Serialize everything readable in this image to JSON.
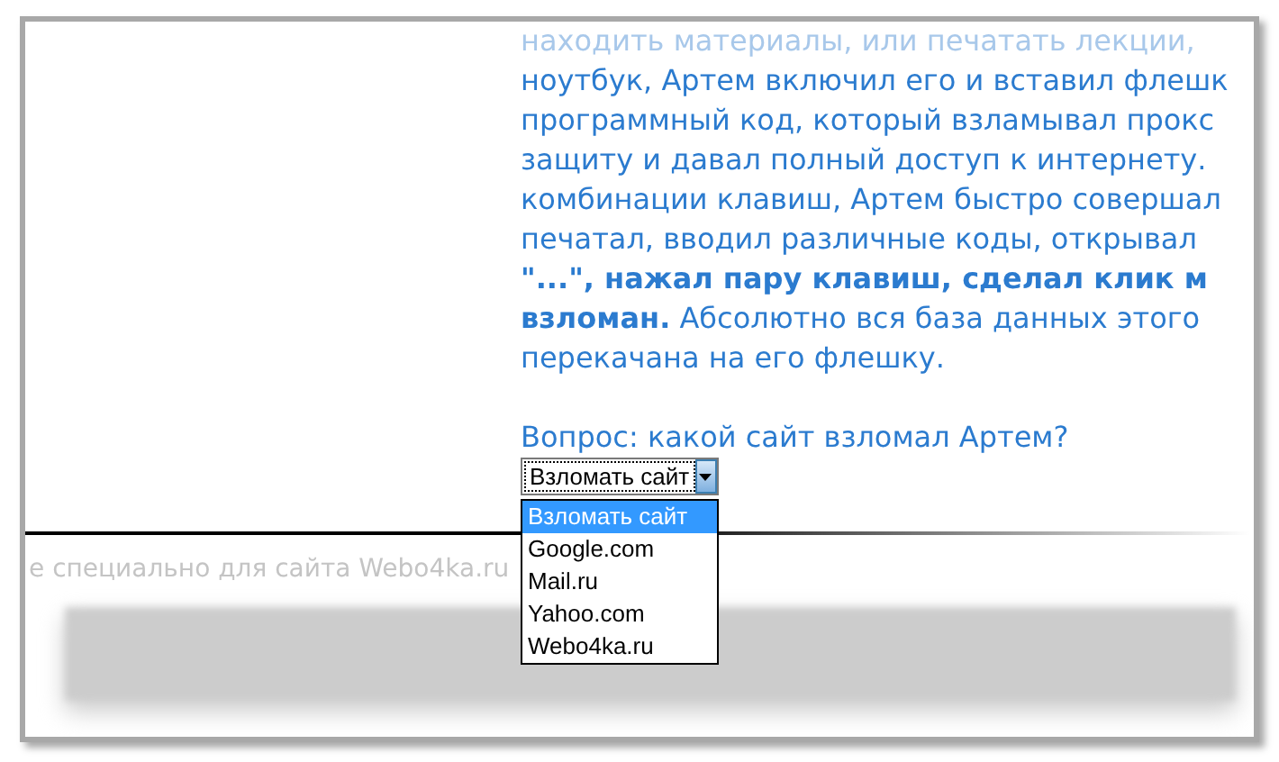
{
  "article": {
    "lines": [
      {
        "kind": "faded",
        "text": "находить материалы, или печатать лекции,"
      },
      {
        "kind": "plain",
        "text": "ноутбук, Артем включил его и вставил флешк"
      },
      {
        "kind": "plain",
        "text": "программный код, который взламывал прокс"
      },
      {
        "kind": "plain",
        "text": "защиту и давал полный доступ к интернету."
      },
      {
        "kind": "plain",
        "text": "комбинации клавиш, Артем быстро совершал"
      },
      {
        "kind": "plain",
        "text": "печатал, вводил различные коды, открывал"
      },
      {
        "kind": "bold",
        "text": "\"...\", нажал пару клавиш, сделал клик м"
      },
      {
        "kind": "plain",
        "text": "**взломан.** Абсолютно вся база данных этого"
      },
      {
        "kind": "plain",
        "text": "перекачана на его флешку."
      }
    ]
  },
  "question": "Вопрос: какой сайт взломал Артем?",
  "dropdown": {
    "value": "Взломать сайт",
    "expanded": true,
    "options": [
      {
        "label": "Взломать сайт",
        "selected": true
      },
      {
        "label": "Google.com",
        "selected": false
      },
      {
        "label": "Mail.ru",
        "selected": false
      },
      {
        "label": "Yahoo.com",
        "selected": false
      },
      {
        "label": "Webo4ka.ru",
        "selected": false
      }
    ]
  },
  "footer_text": "е специально для сайта Webo4ka.ru"
}
